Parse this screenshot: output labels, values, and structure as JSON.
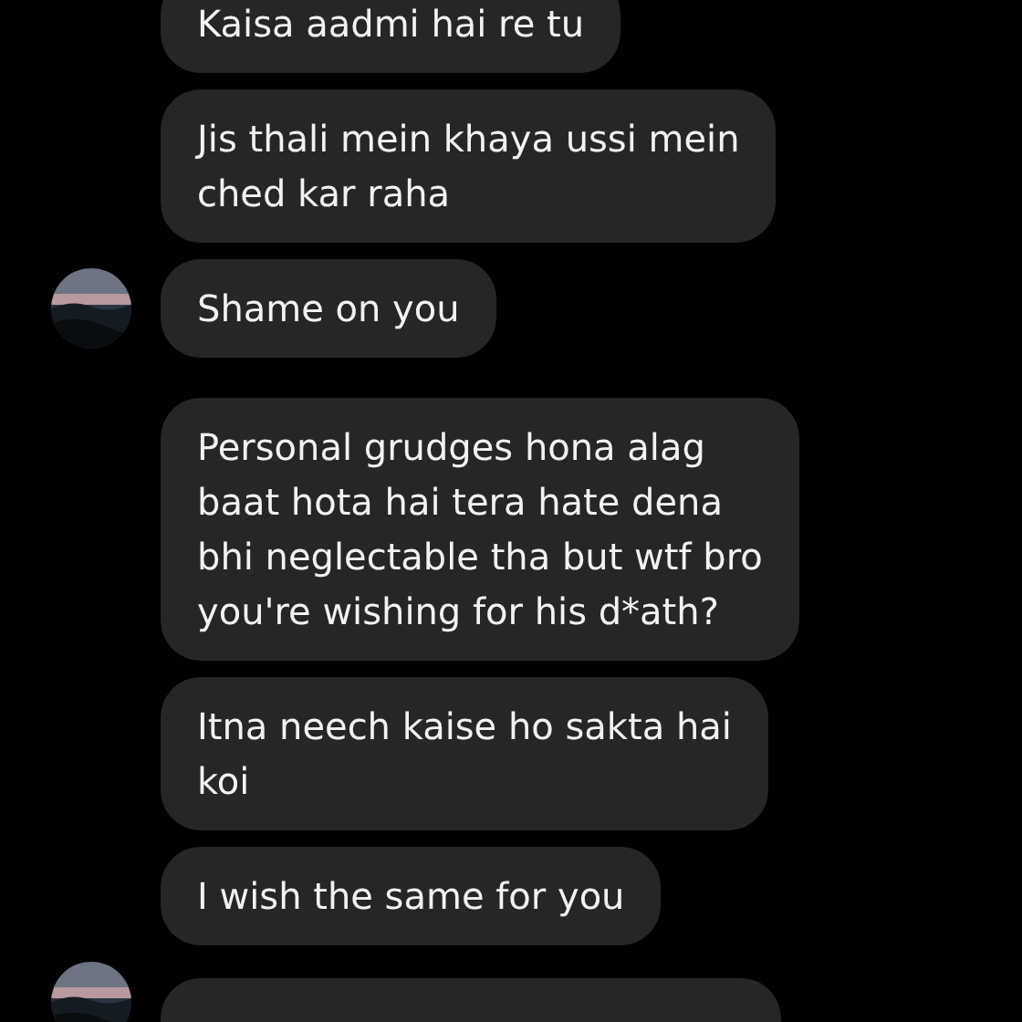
{
  "messages": [
    {
      "kind": "text",
      "text": "Kaisa aadmi hai re tu",
      "avatar": false
    },
    {
      "kind": "text",
      "text": "Jis thali mein khaya ussi mein\nched kar raha",
      "avatar": false
    },
    {
      "kind": "text",
      "text": "Shame on you",
      "avatar": true
    },
    {
      "kind": "text",
      "text": "Personal grudges hona alag\nbaat hota hai tera hate dena\nbhi neglectable tha but wtf bro\nyou're wishing for his d*ath?",
      "avatar": false
    },
    {
      "kind": "text",
      "text": "Itna neech kaise ho sakta hai\nkoi",
      "avatar": false
    },
    {
      "kind": "text",
      "text": "I wish the same for you",
      "avatar": false
    },
    {
      "kind": "partial",
      "avatar": true
    }
  ]
}
